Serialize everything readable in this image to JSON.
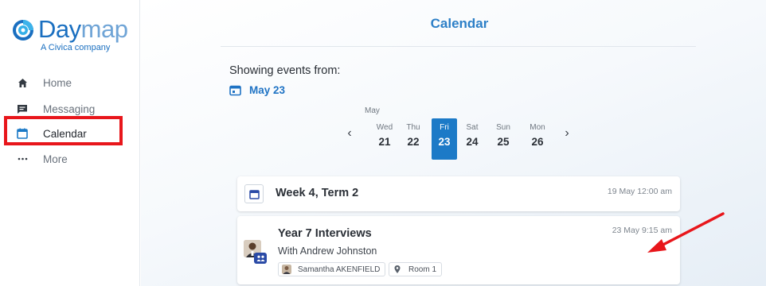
{
  "brand": {
    "name_bold": "Day",
    "name_light": "map",
    "tagline": "A Civica company"
  },
  "sidebar": {
    "items": [
      {
        "label": "Home",
        "icon": "home-icon"
      },
      {
        "label": "Messaging",
        "icon": "message-icon"
      },
      {
        "label": "Calendar",
        "icon": "calendar-icon",
        "active": true
      },
      {
        "label": "More",
        "icon": "more-dots-icon"
      }
    ]
  },
  "page": {
    "title": "Calendar",
    "showing_label": "Showing events from:",
    "date_value": "May 23"
  },
  "week": {
    "month": "May",
    "days": [
      {
        "name": "Wed",
        "date": "21"
      },
      {
        "name": "Thu",
        "date": "22"
      },
      {
        "name": "Fri",
        "date": "23",
        "selected": true
      },
      {
        "name": "Sat",
        "date": "24"
      },
      {
        "name": "Sun",
        "date": "25"
      },
      {
        "name": "Mon",
        "date": "26"
      }
    ],
    "prev_glyph": "‹",
    "next_glyph": "›"
  },
  "events": [
    {
      "title": "Week 4, Term 2",
      "time": "19 May 12:00 am"
    },
    {
      "title": "Year 7 Interviews",
      "subtitle": "With Andrew Johnston",
      "time": "23 May 9:15 am",
      "person": "Samantha AKENFIELD",
      "location": "Room 1"
    }
  ],
  "colors": {
    "accent": "#1c7ac7",
    "highlight": "#e8161b",
    "badge": "#2a4aa6"
  }
}
